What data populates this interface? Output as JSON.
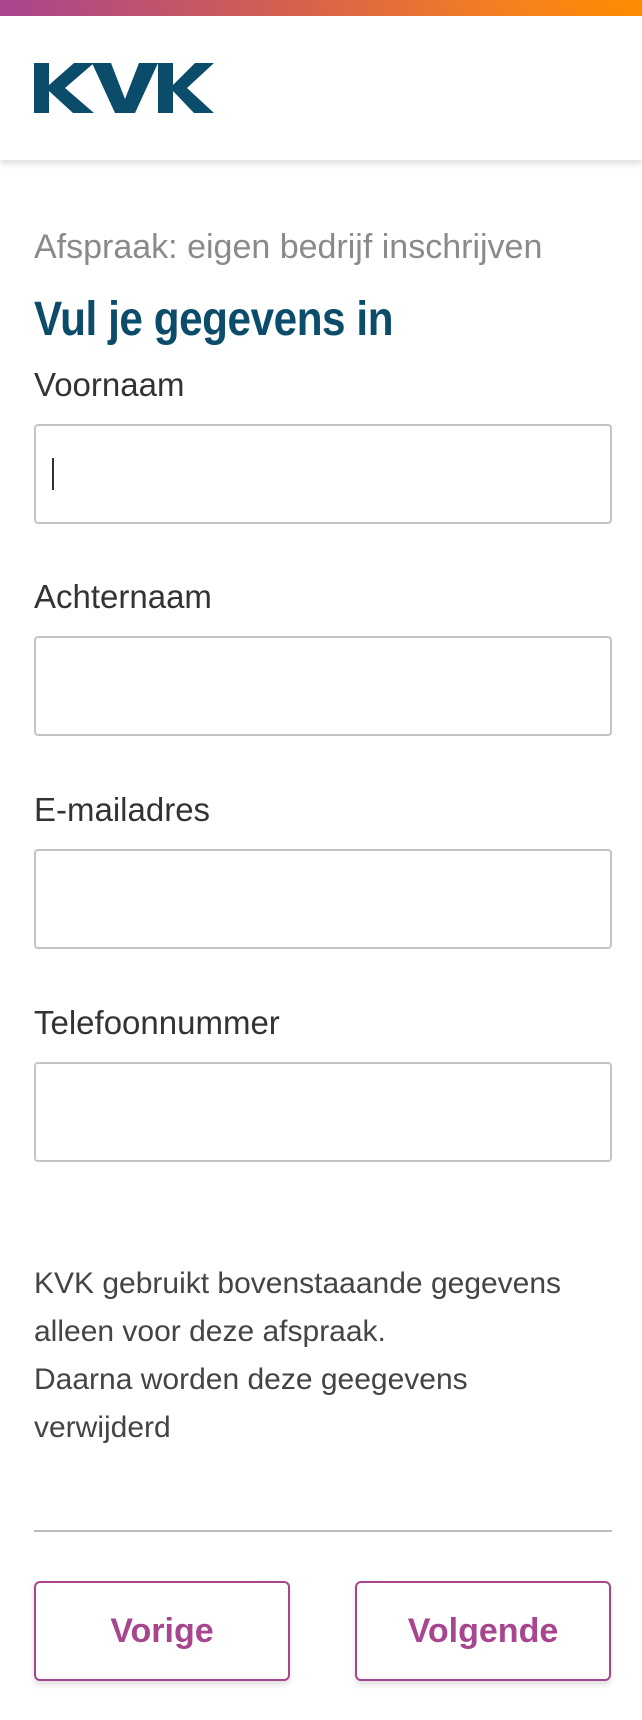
{
  "brand": {
    "logo_text": "KVK",
    "logo_color": "#0a4c6a",
    "accent_color": "#a8458f"
  },
  "page": {
    "subtitle": "Afspraak: eigen bedrijf inschrijven",
    "title": "Vul je gegevens in"
  },
  "form": {
    "first_name": {
      "label": "Voornaam",
      "value": ""
    },
    "last_name": {
      "label": "Achternaam",
      "value": ""
    },
    "email": {
      "label": "E-mailadres",
      "value": ""
    },
    "phone": {
      "label": "Telefoonnummer",
      "value": ""
    }
  },
  "notice": {
    "line1": "KVK gebruikt bovenstaaande gegevens",
    "line2": "alleen voor deze afspraak.",
    "line3": "Daarna worden deze geegevens",
    "line4": "verwijderd"
  },
  "nav": {
    "prev_label": "Vorige",
    "next_label": "Volgende"
  }
}
